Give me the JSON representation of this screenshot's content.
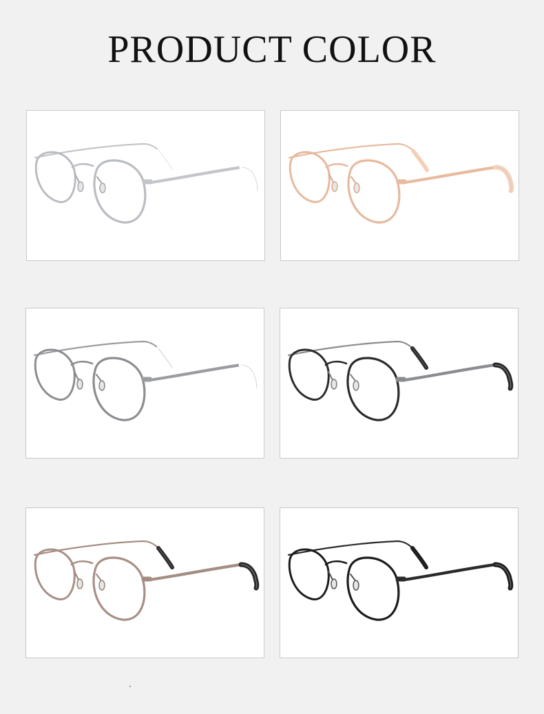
{
  "title": "PRODUCT COLOR",
  "variants": [
    {
      "frame": "#b9bcc2",
      "temple": "#c3c5c9",
      "tip": "#ffffff",
      "nose": "#a8aaae"
    },
    {
      "frame": "#e7b99e",
      "temple": "#e8bba0",
      "tip": "#f6d2bd",
      "nose": "#d8a98f"
    },
    {
      "frame": "#8b8d91",
      "temple": "#9a9ca0",
      "tip": "#ffffff",
      "nose": "#808286"
    },
    {
      "frame": "#2b2b2e",
      "temple": "#8a8c90",
      "tip": "#2a2a2d",
      "nose": "#7c7e82"
    },
    {
      "frame": "#a88f84",
      "temple": "#a48d83",
      "tip": "#2a2a2d",
      "nose": "#9a8378"
    },
    {
      "frame": "#1c1c1e",
      "temple": "#2a2a2c",
      "tip": "#1e1e20",
      "nose": "#505255"
    }
  ]
}
